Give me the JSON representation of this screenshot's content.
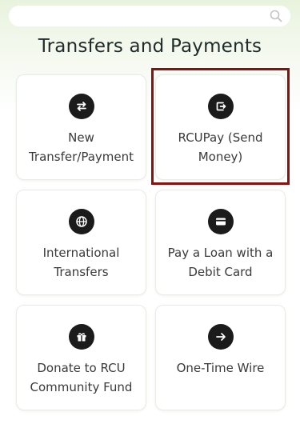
{
  "search": {
    "placeholder": ""
  },
  "title": "Transfers and Payments",
  "tiles": [
    {
      "label_line1": "New",
      "label_line2": "Transfer/Payment",
      "icon": "swap-arrows-icon"
    },
    {
      "label_line1": "RCUPay (Send",
      "label_line2": "Money)",
      "icon": "send-money-icon",
      "selected": true
    },
    {
      "label_line1": "International",
      "label_line2": "Transfers",
      "icon": "globe-icon"
    },
    {
      "label_line1": "Pay a Loan with a",
      "label_line2": "Debit Card",
      "icon": "credit-card-icon"
    },
    {
      "label_line1": "Donate to RCU",
      "label_line2": "Community Fund",
      "icon": "gift-icon"
    },
    {
      "label_line1": "One-Time Wire",
      "label_line2": "",
      "icon": "arrow-right-icon"
    }
  ],
  "colors": {
    "selected_outline": "#8b1111",
    "icon_bg": "#1b1b1b"
  }
}
